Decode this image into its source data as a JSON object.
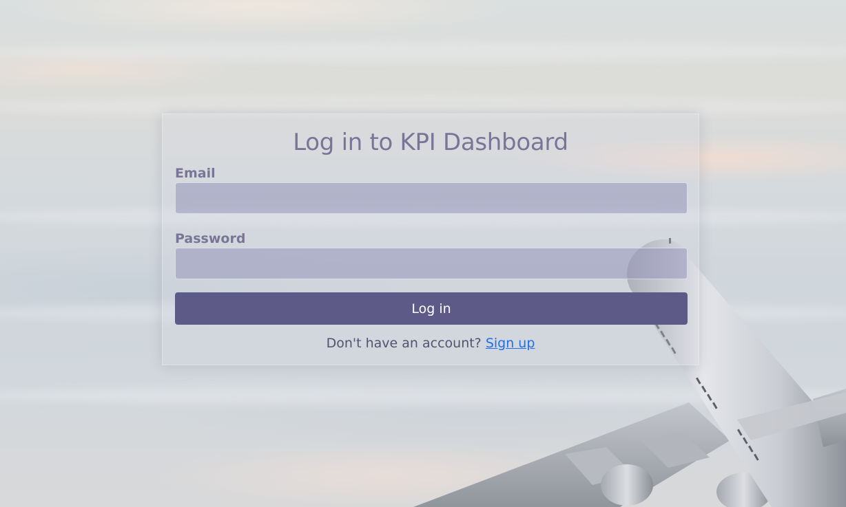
{
  "login": {
    "title": "Log in to KPI Dashboard",
    "email_label": "Email",
    "email_value": "",
    "password_label": "Password",
    "password_value": "",
    "submit_label": "Log in",
    "signup_prompt": "Don't have an account?",
    "signup_link": "Sign up"
  },
  "colors": {
    "accent": "#5e5a88",
    "link": "#1f6feb",
    "label": "#7a7596"
  },
  "background": {
    "scene_icon": "airplane-above-clouds"
  }
}
